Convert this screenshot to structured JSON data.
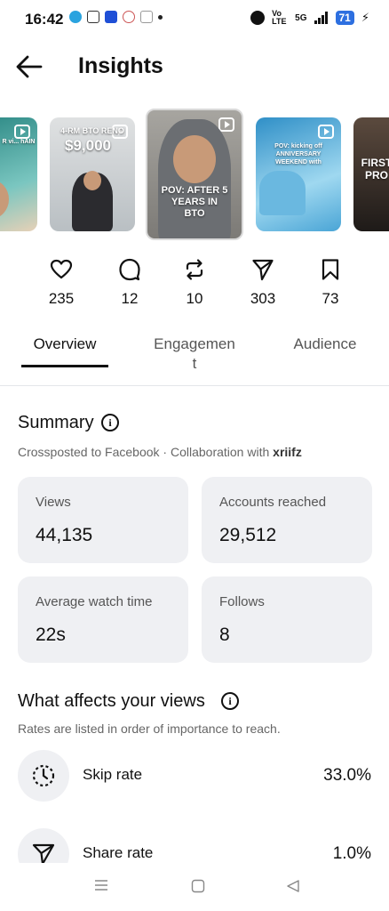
{
  "status_bar": {
    "time": "16:42",
    "battery": "71",
    "network": "5G",
    "volte": "Vo LTE"
  },
  "header": {
    "title": "Insights"
  },
  "reels": [
    {
      "caption": "R vi... hAIN"
    },
    {
      "caption": "4-RM BTO RENO",
      "price": "$9,000"
    },
    {
      "caption": "POV: AFTER 5 YEARS IN BTO"
    },
    {
      "caption": "POV: kicking off ANNIVERSARY WEEKEND with"
    },
    {
      "caption": "FIRST PRO"
    }
  ],
  "stats": {
    "likes": "235",
    "comments": "12",
    "reposts": "10",
    "shares": "303",
    "saves": "73"
  },
  "tabs": {
    "overview": "Overview",
    "engagement": "Engagemen\nt",
    "audience": "Audience"
  },
  "summary": {
    "title": "Summary",
    "crosspost_prefix": "Crossposted to Facebook · Collaboration with ",
    "collaborator": "xriifz",
    "cards": [
      {
        "label": "Views",
        "value": "44,135"
      },
      {
        "label": "Accounts reached",
        "value": "29,512"
      },
      {
        "label": "Average watch time",
        "value": "22s"
      },
      {
        "label": "Follows",
        "value": "8"
      }
    ]
  },
  "affects": {
    "title": "What affects your views",
    "subtitle": "Rates are listed in order of importance to reach.",
    "items": [
      {
        "name": "Skip rate",
        "value": "33.0%"
      },
      {
        "name": "Share rate",
        "value": "1.0%"
      }
    ]
  }
}
